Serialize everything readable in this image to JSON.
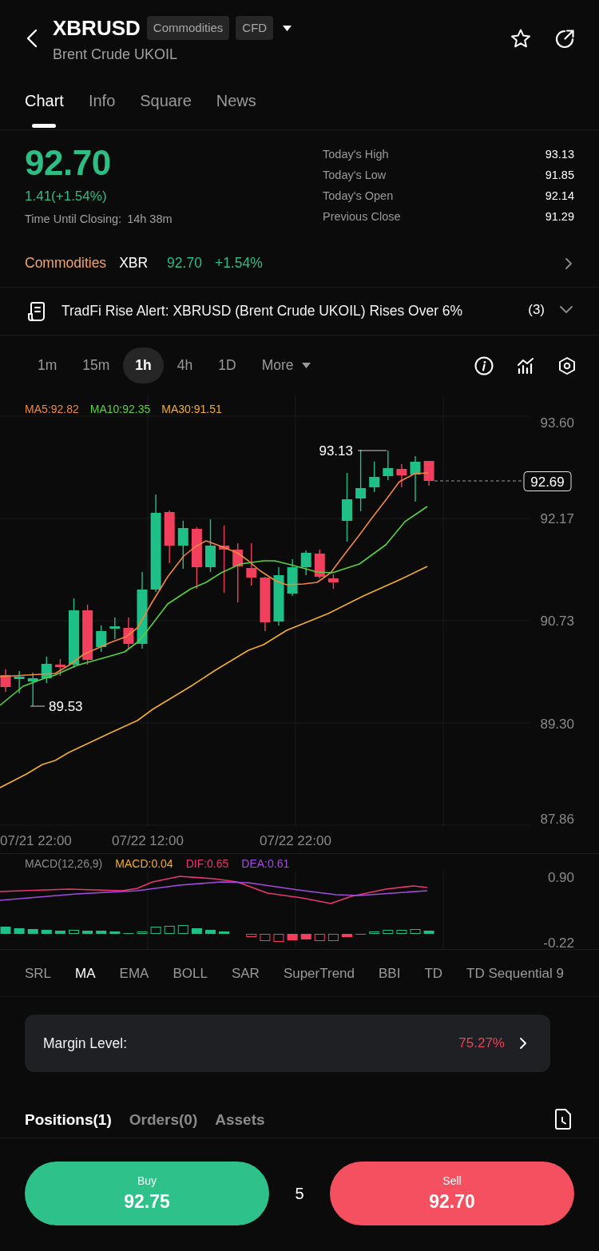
{
  "header": {
    "symbol": "XBRUSD",
    "tags": [
      "Commodities",
      "CFD"
    ],
    "name": "Brent Crude UKOIL"
  },
  "tabs": [
    {
      "label": "Chart",
      "selected": true
    },
    {
      "label": "Info",
      "selected": false
    },
    {
      "label": "Square",
      "selected": false
    },
    {
      "label": "News",
      "selected": false
    }
  ],
  "quote": {
    "price": "92.70",
    "change": "1.41(+1.54%)",
    "closing_label": "Time Until Closing:",
    "closing_value": "14h 38m"
  },
  "stats": [
    {
      "label": "Today's High",
      "value": "93.13"
    },
    {
      "label": "Today's Low",
      "value": "91.85"
    },
    {
      "label": "Today's Open",
      "value": "92.14"
    },
    {
      "label": "Previous Close",
      "value": "91.29"
    }
  ],
  "sector": {
    "category": "Commodities",
    "ticker": "XBR",
    "price": "92.70",
    "change": "+1.54%"
  },
  "alert": {
    "text": "TradFi Rise Alert: XBRUSD (Brent Crude UKOIL) Rises Over 6%",
    "count": "(3)"
  },
  "intervals": [
    {
      "label": "1m",
      "kind": "interval",
      "selected": false
    },
    {
      "label": "15m",
      "kind": "interval",
      "selected": false
    },
    {
      "label": "1h",
      "kind": "interval",
      "selected": true
    },
    {
      "label": "4h",
      "kind": "interval",
      "selected": false
    },
    {
      "label": "1D",
      "kind": "interval",
      "selected": false
    },
    {
      "label": "More",
      "kind": "dropdown",
      "selected": false
    }
  ],
  "chart": {
    "legend": [
      {
        "label": "MA5:92.82",
        "color": "#f0883e"
      },
      {
        "label": "MA10:92.35",
        "color": "#5ad141"
      },
      {
        "label": "MA30:91.51",
        "color": "#f2ae2e"
      }
    ],
    "price_axis": [
      "93.60",
      "92.17",
      "90.73",
      "89.30",
      "87.86"
    ],
    "high_marker": "93.13",
    "low_marker": "89.53",
    "last_price": "92.69",
    "time_axis": [
      "07/21 22:00",
      "07/22 12:00",
      "07/22 22:00"
    ]
  },
  "macd": {
    "legend": [
      {
        "label": "MACD(12,26,9)",
        "color": "#8c8c8c"
      },
      {
        "label": "MACD:0.04",
        "color": "#f2ae2e"
      },
      {
        "label": "DIF:0.65",
        "color": "#e8386f"
      },
      {
        "label": "DEA:0.61",
        "color": "#a34ce0"
      }
    ],
    "axis": [
      "0.90",
      "-0.22"
    ]
  },
  "indicators": [
    {
      "label": "SRL",
      "selected": false
    },
    {
      "label": "MA",
      "selected": true
    },
    {
      "label": "EMA",
      "selected": false
    },
    {
      "label": "BOLL",
      "selected": false
    },
    {
      "label": "SAR",
      "selected": false
    },
    {
      "label": "SuperTrend",
      "selected": false
    },
    {
      "label": "BBI",
      "selected": false
    },
    {
      "label": "TD",
      "selected": false
    },
    {
      "label": "TD Sequential 9",
      "selected": false
    }
  ],
  "margin": {
    "label": "Margin Level:",
    "value": "75.27%"
  },
  "position_tabs": [
    {
      "label": "Positions(1)",
      "selected": true
    },
    {
      "label": "Orders(0)",
      "selected": false
    },
    {
      "label": "Assets",
      "selected": false
    }
  ],
  "trade": {
    "buy": {
      "label": "Buy",
      "price": "92.75"
    },
    "quantity": "5",
    "sell": {
      "label": "Sell",
      "price": "92.70"
    }
  }
}
